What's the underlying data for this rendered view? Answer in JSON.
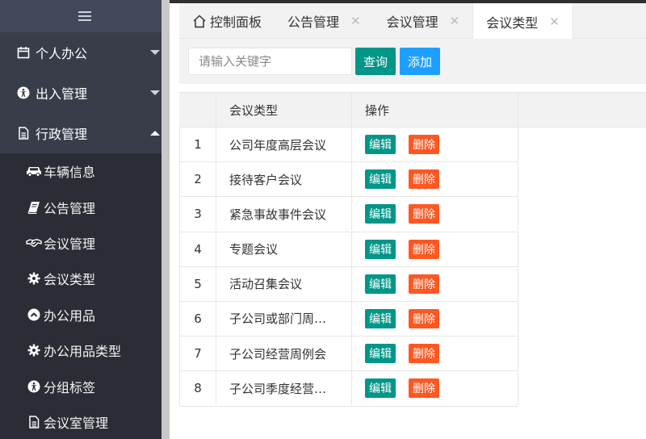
{
  "sidebar": {
    "groups": [
      {
        "label": "个人办公",
        "icon": "calendar-icon",
        "expanded": false
      },
      {
        "label": "出入管理",
        "icon": "accessibility-icon",
        "expanded": false
      },
      {
        "label": "行政管理",
        "icon": "document-icon",
        "expanded": true
      }
    ],
    "items": [
      {
        "label": "车辆信息",
        "icon": "car-icon"
      },
      {
        "label": "公告管理",
        "icon": "book-icon"
      },
      {
        "label": "会议管理",
        "icon": "handshake-icon"
      },
      {
        "label": "会议类型",
        "icon": "gear-icon"
      },
      {
        "label": "办公用品",
        "icon": "chevron-up-circle-icon"
      },
      {
        "label": "办公用品类型",
        "icon": "gear-icon"
      },
      {
        "label": "分组标签",
        "icon": "accessibility-icon"
      },
      {
        "label": "会议室管理",
        "icon": "document-icon"
      }
    ]
  },
  "tabs": [
    {
      "label": "控制面板",
      "icon": "home-icon",
      "closable": false,
      "active": false
    },
    {
      "label": "公告管理",
      "closable": true,
      "active": false
    },
    {
      "label": "会议管理",
      "closable": true,
      "active": false
    },
    {
      "label": "会议类型",
      "closable": true,
      "active": true
    }
  ],
  "toolbar": {
    "search_placeholder": "请输入关键字",
    "query_label": "查询",
    "add_label": "添加"
  },
  "table": {
    "headers": [
      "",
      "会议类型",
      "操作"
    ],
    "edit_label": "编辑",
    "delete_label": "删除",
    "rows": [
      {
        "num": "1",
        "name": "公司年度高层会议"
      },
      {
        "num": "2",
        "name": "接待客户会议"
      },
      {
        "num": "3",
        "name": "紧急事故事件会议"
      },
      {
        "num": "4",
        "name": "专题会议"
      },
      {
        "num": "5",
        "name": "活动召集会议"
      },
      {
        "num": "6",
        "name": "子公司或部门周…"
      },
      {
        "num": "7",
        "name": "子公司经营周例会"
      },
      {
        "num": "8",
        "name": "子公司季度经营…"
      }
    ]
  },
  "colors": {
    "sidebar_bg": "#393D49",
    "submenu_bg": "#2a2d35",
    "primary_green": "#009688",
    "blue": "#1E9FFF",
    "danger": "#FF5722"
  }
}
